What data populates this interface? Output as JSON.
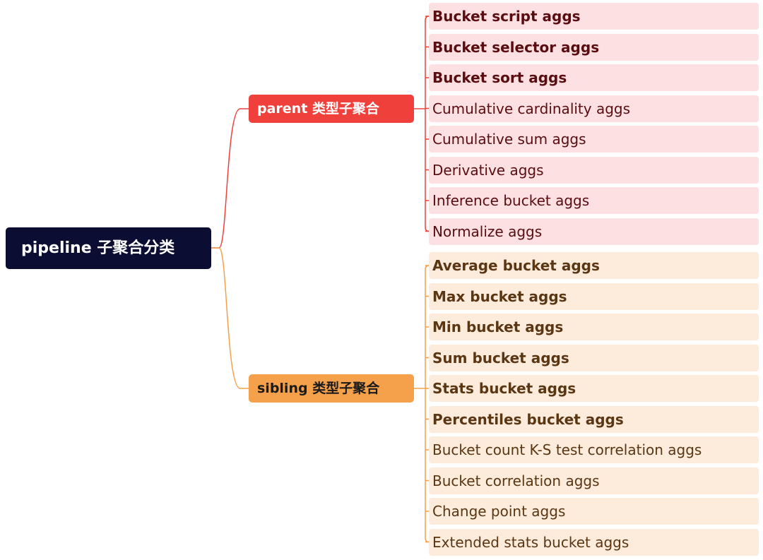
{
  "colors": {
    "root_bg": "#0b0d33",
    "parent_branch": "#f0403b",
    "sibling_branch": "#f5a14b",
    "parent_leaf_bg": "#fde0e2",
    "sibling_leaf_bg": "#fdebdc"
  },
  "root": {
    "label": "pipeline 子聚合分类"
  },
  "parent": {
    "label": "parent 类型子聚合",
    "items": [
      {
        "label": "Bucket script aggs",
        "bold": true
      },
      {
        "label": "Bucket selector aggs",
        "bold": true
      },
      {
        "label": "Bucket sort aggs",
        "bold": true
      },
      {
        "label": "Cumulative cardinality aggs",
        "bold": false
      },
      {
        "label": "Cumulative sum aggs",
        "bold": false
      },
      {
        "label": "Derivative aggs",
        "bold": false
      },
      {
        "label": "Inference bucket aggs",
        "bold": false
      },
      {
        "label": "Normalize aggs",
        "bold": false
      }
    ]
  },
  "sibling": {
    "label": "sibling 类型子聚合",
    "items": [
      {
        "label": "Average bucket aggs",
        "bold": true
      },
      {
        "label": "Max bucket aggs",
        "bold": true
      },
      {
        "label": "Min bucket aggs",
        "bold": true
      },
      {
        "label": "Sum bucket aggs",
        "bold": true
      },
      {
        "label": "Stats bucket aggs",
        "bold": true
      },
      {
        "label": "Percentiles bucket aggs",
        "bold": true
      },
      {
        "label": "Bucket count K-S test correlation aggs",
        "bold": false
      },
      {
        "label": "Bucket correlation aggs",
        "bold": false
      },
      {
        "label": "Change point aggs",
        "bold": false
      },
      {
        "label": "Extended stats bucket aggs",
        "bold": false
      }
    ]
  }
}
